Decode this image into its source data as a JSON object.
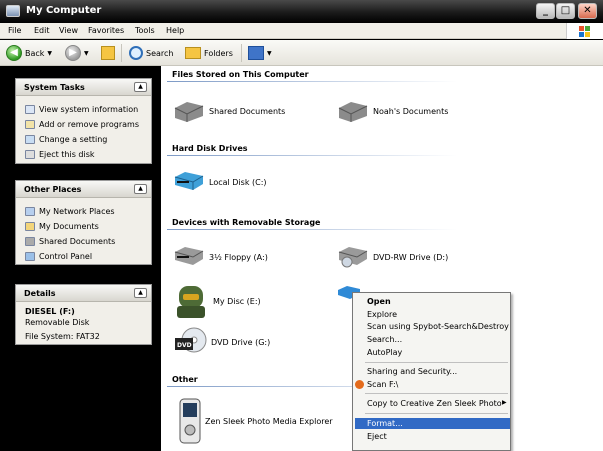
{
  "window": {
    "title": "My Computer"
  },
  "menubar": [
    "File",
    "Edit",
    "View",
    "Favorites",
    "Tools",
    "Help"
  ],
  "toolbar": {
    "back": "Back",
    "search": "Search",
    "folders": "Folders"
  },
  "tasks": {
    "system": {
      "title": "System Tasks",
      "items": [
        "View system information",
        "Add or remove programs",
        "Change a setting",
        "Eject this disk"
      ]
    },
    "other": {
      "title": "Other Places",
      "items": [
        "My Network Places",
        "My Documents",
        "Shared Documents",
        "Control Panel"
      ]
    },
    "details": {
      "title": "Details",
      "name": "DIESEL (F:)",
      "type": "Removable Disk",
      "fs": "File System: FAT32"
    }
  },
  "sections": {
    "files": "Files Stored on This Computer",
    "hdd": "Hard Disk Drives",
    "removable": "Devices with Removable Storage",
    "other": "Other"
  },
  "items": {
    "shared_docs": "Shared Documents",
    "noah_docs": "Noah's Documents",
    "local_disk": "Local Disk (C:)",
    "floppy": "3½ Floppy (A:)",
    "dvdrw": "DVD-RW Drive (D:)",
    "mydisc": "My Disc (E:)",
    "dvd": "DVD Drive (G:)",
    "zen": "Zen Sleek Photo Media Explorer"
  },
  "context_menu": {
    "open": "Open",
    "explore": "Explore",
    "spybot": "Scan using Spybot-Search&Destroy",
    "search": "Search...",
    "autoplay": "AutoPlay",
    "sharing": "Sharing and Security...",
    "scan": "Scan F:\\",
    "copy_to": "Copy to Creative Zen Sleek Photo",
    "format": "Format...",
    "eject": "Eject"
  },
  "colors": {
    "titlebar": "#1a1a1a",
    "highlight": "#316ac5",
    "panel_bg": "#000000",
    "content_bg": "#ffffff"
  }
}
